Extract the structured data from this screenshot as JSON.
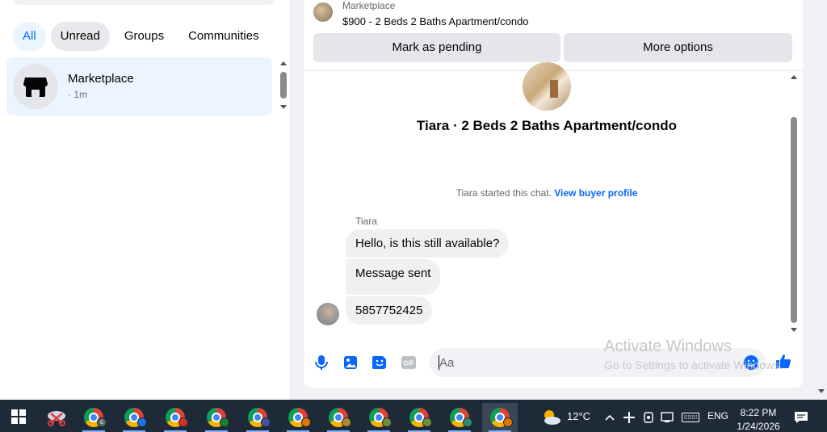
{
  "sidebar": {
    "filters": [
      {
        "label": "All",
        "active": true
      },
      {
        "label": "Unread",
        "active": false
      },
      {
        "label": "Groups",
        "active": false
      },
      {
        "label": "Communities",
        "active": false
      }
    ],
    "thread": {
      "name": "Marketplace",
      "time": "· 1m"
    }
  },
  "chat": {
    "header": {
      "label": "Marketplace",
      "listing": "$900 - 2 Beds 2 Baths Apartment/condo"
    },
    "actions": {
      "pending": "Mark as pending",
      "more": "More options"
    },
    "listing_title": "Tiara · 2 Beds 2 Baths Apartment/condo",
    "started_text": "Tiara started this chat.",
    "buyer_link": "View buyer profile",
    "sender": "Tiara",
    "messages": [
      "Hello, is this still available?",
      "Message sent",
      "5857752425"
    ],
    "composer": {
      "placeholder": "Aa"
    }
  },
  "watermark": {
    "title": "Activate Windows",
    "subtitle": "Go to Settings to activate Windows."
  },
  "taskbar": {
    "weather": "12°C",
    "language": "ENG",
    "time": "8:22 PM",
    "date": "1/24/2026"
  },
  "colors": {
    "accent": "#0866ff",
    "bubble": "#f0f0f0",
    "taskbar": "#1f2a38"
  }
}
